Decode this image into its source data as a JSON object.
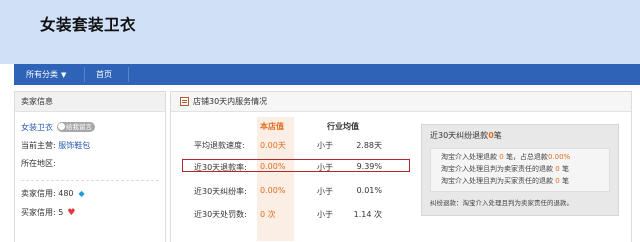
{
  "header": {
    "shop_name": "女装套装卫衣"
  },
  "navbar": {
    "all_categories": "所有分类",
    "home": "首页"
  },
  "seller_info": {
    "title": "卖家信息",
    "seller_name": "女装卫衣",
    "message_label": "给我留言",
    "main_category_label": "当前主营:",
    "main_category_value": "服饰鞋包",
    "location_label": "所在地区:",
    "location_value": "",
    "seller_credit_label": "卖家信用:",
    "seller_credit_value": "480",
    "buyer_credit_label": "买家信用:",
    "buyer_credit_value": "5"
  },
  "service": {
    "title": "店铺30天内服务情况",
    "col_shop": "本店值",
    "col_avg": "行业均值",
    "rows": [
      {
        "label": "平均退款速度:",
        "shop": "0.00天",
        "cmp": "小于",
        "avg": "2.88天"
      },
      {
        "label": "近30天退款率:",
        "shop": "0.00%",
        "cmp": "小于",
        "avg": "9.39%"
      },
      {
        "label": "近30天纠纷率:",
        "shop": "0.00%",
        "cmp": "小于",
        "avg": "0.01%"
      },
      {
        "label": "近30天处罚数:",
        "shop": "0 次",
        "cmp": "小于",
        "avg": "1.14 次"
      }
    ]
  },
  "dispute": {
    "title_prefix": "近30天纠纷退款",
    "title_count": "0",
    "title_suffix": "笔",
    "line1_prefix": "淘宝介入处理退款",
    "line1_count": "0",
    "line1_mid": "笔，占总退款",
    "line1_pct": "0.00%",
    "line2_prefix": "淘宝介入处理且判为卖家责任的退款",
    "line2_count": "0",
    "line2_suffix": "笔",
    "line3_prefix": "淘宝介入处理且判为买家责任的退款",
    "line3_count": "0",
    "line3_suffix": "笔",
    "footnote": "纠纷退款：淘宝介入处理且判为卖家责任的退款。"
  },
  "colors": {
    "nav": "#2f63b7",
    "header": "#cfe0f7",
    "accent": "#e36c1d",
    "highlight": "#b3282f"
  },
  "icons": {
    "dropdown": "triangle-down-icon",
    "diamond": "diamond-icon",
    "heart": "heart-icon",
    "panel": "document-icon"
  }
}
